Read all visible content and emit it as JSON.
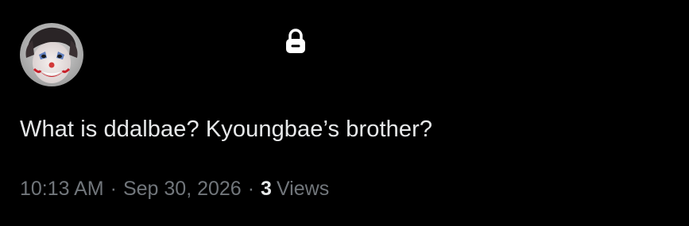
{
  "tweet": {
    "text": "What is ddalbae? Kyoungbae’s brother?",
    "time": "10:13 AM",
    "separator": "·",
    "date": "Sep 30, 2026",
    "views_count": "3",
    "views_label": "Views"
  },
  "icons": {
    "lock": "lock-icon",
    "avatar": "avatar"
  },
  "colors": {
    "background": "#000000",
    "text_primary": "#e7e9ea",
    "text_secondary": "#71767b"
  }
}
